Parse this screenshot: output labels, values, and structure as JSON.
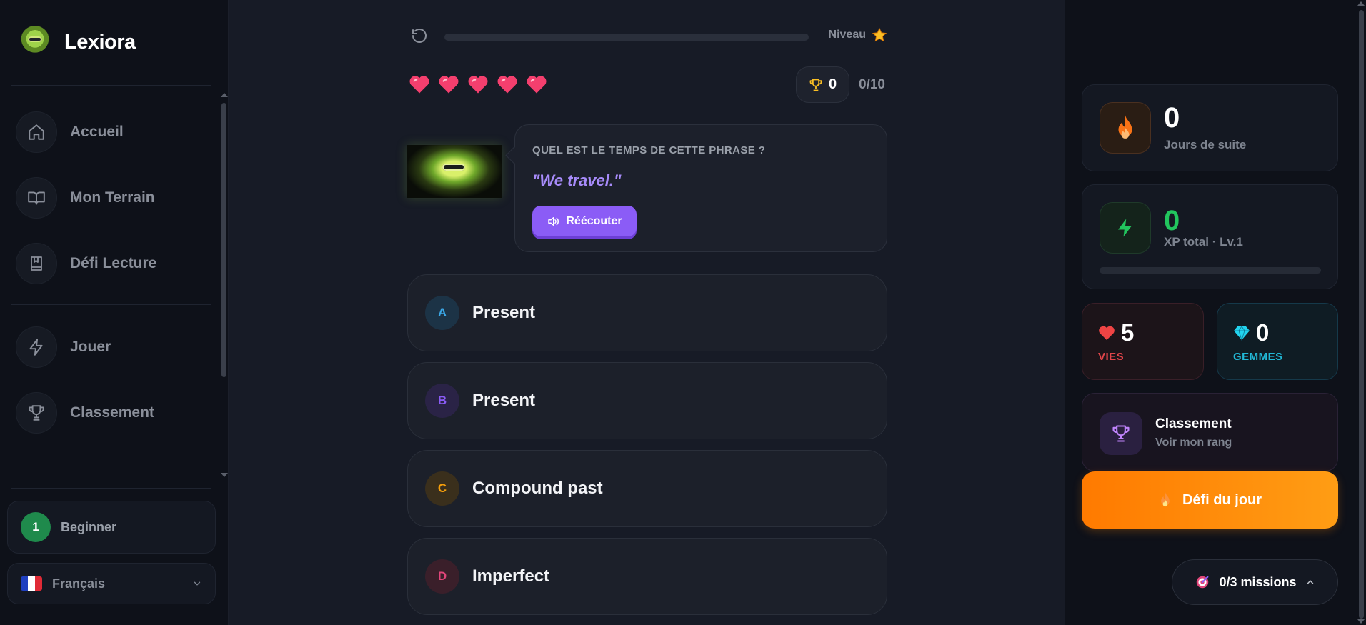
{
  "app": {
    "name": "Lexiora"
  },
  "sidebar": {
    "items": [
      {
        "label": "Accueil",
        "icon": "home-icon"
      },
      {
        "label": "Mon Terrain",
        "icon": "book-open-icon"
      },
      {
        "label": "Défi Lecture",
        "icon": "book-icon"
      },
      {
        "label": "Jouer",
        "icon": "lightning-icon"
      },
      {
        "label": "Classement",
        "icon": "trophy-icon"
      }
    ],
    "level": {
      "number": "1",
      "label": "Beginner"
    },
    "language": {
      "label": "Français",
      "flag": "france-flag-icon"
    }
  },
  "quiz": {
    "level_label": "Niveau",
    "progress": 0,
    "lives": 5,
    "trophy_count": "0",
    "score": "0/10",
    "question": "QUEL EST LE TEMPS DE CETTE PHRASE ?",
    "sentence": "\"We travel.\"",
    "replay_label": "Réécouter",
    "options": [
      {
        "letter": "A",
        "text": "Present",
        "color": "#3ba7e6",
        "bg": "#1c3346"
      },
      {
        "letter": "B",
        "text": "Present",
        "color": "#8b5cf6",
        "bg": "#2a2346"
      },
      {
        "letter": "C",
        "text": "Compound past",
        "color": "#f59e0b",
        "bg": "#3a2f1c"
      },
      {
        "letter": "D",
        "text": "Imperfect",
        "color": "#e0457a",
        "bg": "#3a1f2a"
      }
    ]
  },
  "stats": {
    "streak": {
      "value": "0",
      "label": "Jours de suite"
    },
    "xp": {
      "value": "0",
      "label": "XP total · Lv.1",
      "progress": 0
    },
    "lives": {
      "value": "5",
      "label": "VIES"
    },
    "gems": {
      "value": "0",
      "label": "GEMMES"
    },
    "ranking": {
      "title": "Classement",
      "subtitle": "Voir mon rang"
    },
    "daily_label": "Défi du jour",
    "missions_label": "0/3 missions"
  },
  "colors": {
    "accent": "#8b5cf6",
    "orange": "#ff8a00",
    "green": "#22c55e",
    "heart": "#ef4444",
    "gem": "#22d3ee"
  }
}
